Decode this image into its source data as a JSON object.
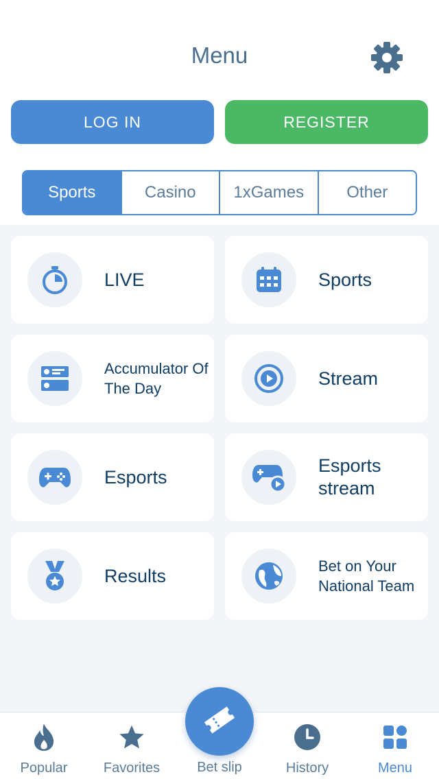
{
  "header": {
    "title": "Menu",
    "settings_icon": "gear-icon"
  },
  "auth": {
    "login_label": "LOG IN",
    "register_label": "REGISTER"
  },
  "tabs": [
    {
      "label": "Sports",
      "active": true
    },
    {
      "label": "Casino",
      "active": false
    },
    {
      "label": "1xGames",
      "active": false
    },
    {
      "label": "Other",
      "active": false
    }
  ],
  "items": [
    {
      "label": "LIVE",
      "icon": "stopwatch-icon"
    },
    {
      "label": "Sports",
      "icon": "calendar-icon"
    },
    {
      "label": "Accumulator Of The Day",
      "icon": "accumulator-list-icon"
    },
    {
      "label": "Stream",
      "icon": "play-circle-icon"
    },
    {
      "label": "Esports",
      "icon": "gamepad-icon"
    },
    {
      "label": "Esports stream",
      "icon": "gamepad-play-icon"
    },
    {
      "label": "Results",
      "icon": "medal-icon"
    },
    {
      "label": "Bet on Your National Team",
      "icon": "globe-icon"
    }
  ],
  "bottom_nav": [
    {
      "label": "Popular",
      "icon": "flame-icon"
    },
    {
      "label": "Favorites",
      "icon": "star-icon"
    },
    {
      "label": "Bet slip",
      "icon": "ticket-icon"
    },
    {
      "label": "History",
      "icon": "clock-icon"
    },
    {
      "label": "Menu",
      "icon": "grid-icon",
      "active": true
    }
  ],
  "colors": {
    "accent": "#4a8ad4",
    "register": "#4bb865",
    "text_dark": "#103d63",
    "muted": "#5b7c99",
    "background": "#f3f5f9"
  }
}
